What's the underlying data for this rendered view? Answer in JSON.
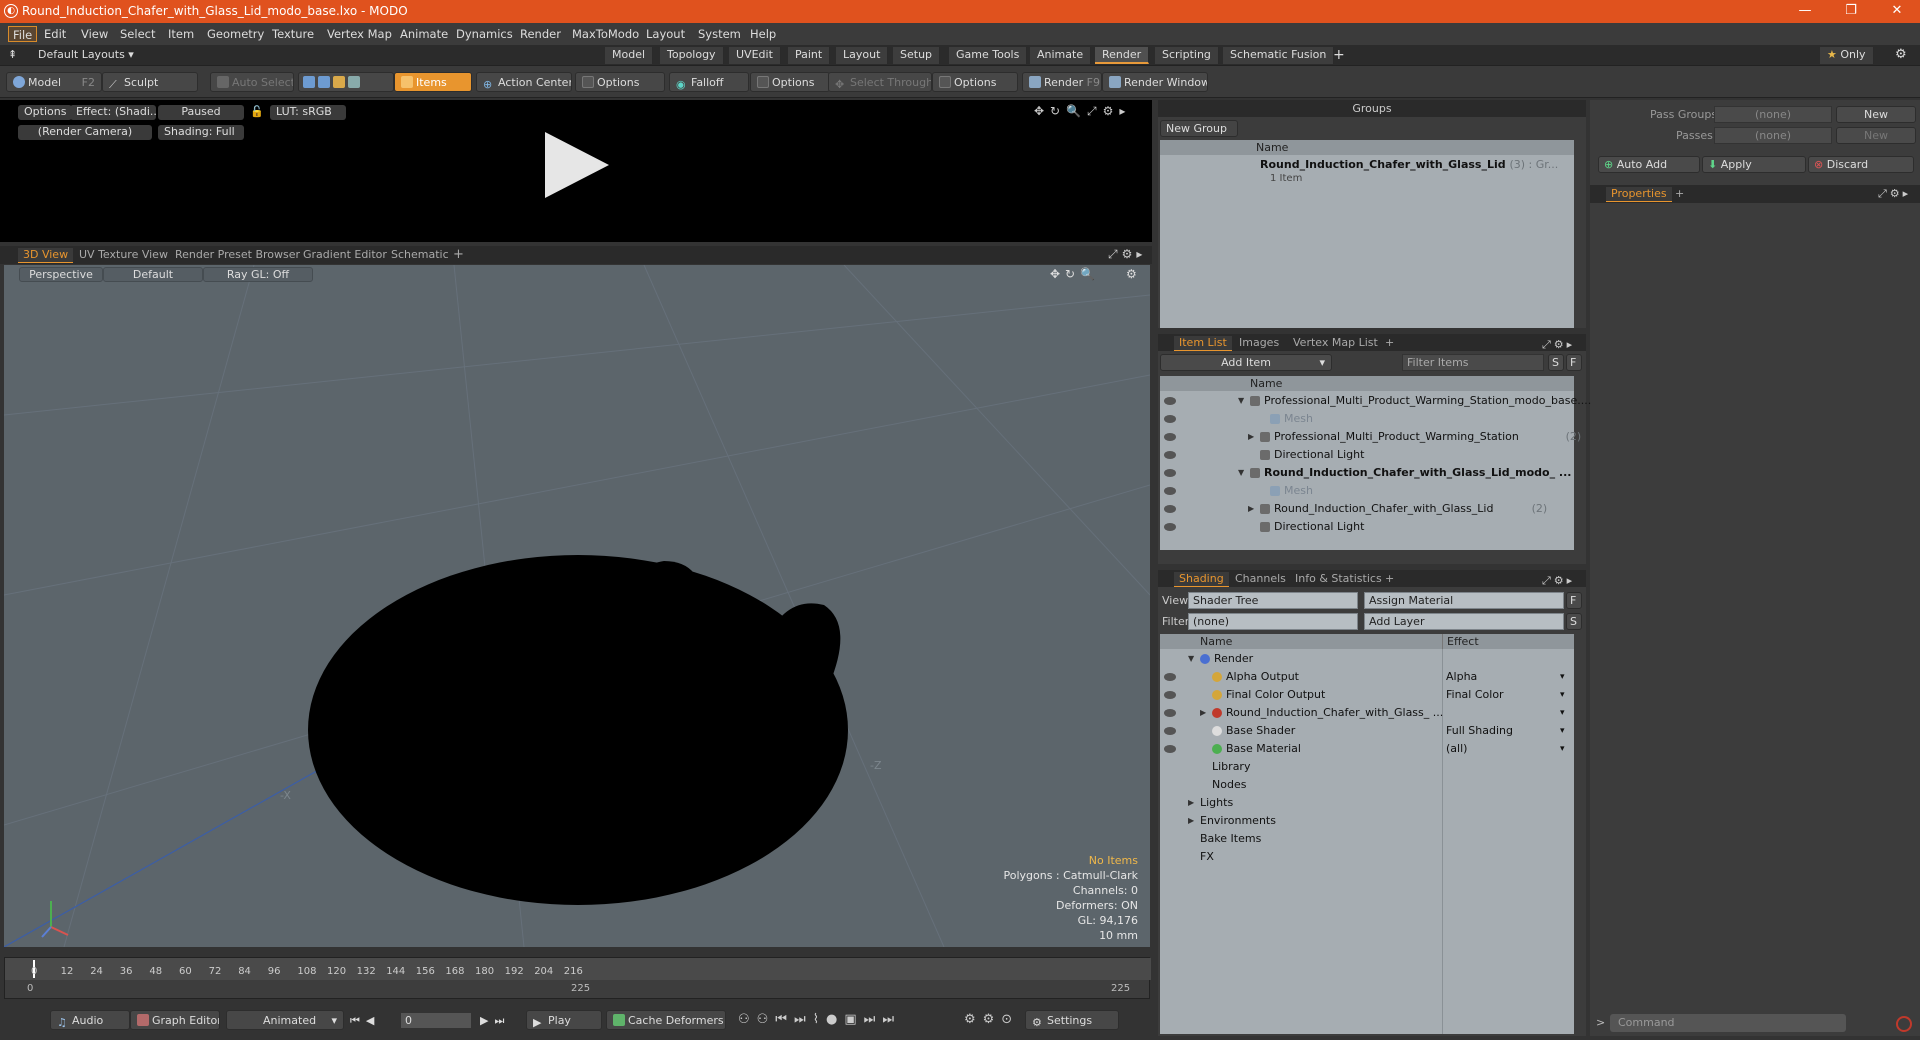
{
  "window": {
    "title": "Round_Induction_Chafer_with_Glass_Lid_modo_base.lxo - MODO"
  },
  "menu": [
    "File",
    "Edit",
    "View",
    "Select",
    "Item",
    "Geometry",
    "Texture",
    "Vertex Map",
    "Animate",
    "Dynamics",
    "Render",
    "MaxToModo",
    "Layout",
    "System",
    "Help"
  ],
  "layouts": {
    "dropdown": "Default Layouts ▾",
    "tabs": [
      "Model",
      "Topology",
      "UVEdit",
      "Paint",
      "Layout",
      "Setup",
      "Game Tools",
      "Animate",
      "Render",
      "Scripting",
      "Schematic Fusion"
    ],
    "active": "Render",
    "only": "Only"
  },
  "toolbar": {
    "model": "Model",
    "model_key": "F2",
    "sculpt": "Sculpt",
    "auto_select": "Auto Select",
    "items": "Items",
    "action_center": "Action Center",
    "options1": "Options",
    "falloff": "Falloff",
    "options2": "Options",
    "select_through": "Select Through",
    "options3": "Options",
    "render": "Render",
    "render_key": "F9",
    "render_window": "Render Window"
  },
  "preview": {
    "options": "Options",
    "effect": "Effect: (Shadi...",
    "paused": "Paused",
    "lut": "LUT: sRGB",
    "camera": "(Render Camera)",
    "shading": "Shading: Full"
  },
  "viewtabs": [
    "3D View",
    "UV Texture View",
    "Render Preset Browser",
    "Gradient Editor",
    "Schematic"
  ],
  "viewport": {
    "perspective": "Perspective",
    "default": "Default",
    "raygl": "Ray GL: Off",
    "no_items": "No Items",
    "polygons": "Polygons : Catmull-Clark",
    "channels": "Channels: 0",
    "deformers": "Deformers: ON",
    "gl": "GL: 94,176",
    "scale": "10 mm",
    "axis_x": "-X",
    "axis_z": "-Z"
  },
  "timeline": {
    "ticks": [
      "0",
      "12",
      "24",
      "36",
      "48",
      "60",
      "72",
      "84",
      "96",
      "108",
      "120",
      "132",
      "144",
      "156",
      "168",
      "180",
      "192",
      "204",
      "216"
    ],
    "start": "0",
    "end": "225",
    "end2": "225"
  },
  "bottom": {
    "audio": "Audio",
    "graph_editor": "Graph Editor",
    "animated": "Animated",
    "frame": "0",
    "play": "Play",
    "cache": "Cache Deformers",
    "settings": "Settings"
  },
  "groups": {
    "title": "Groups",
    "new_group": "New Group",
    "name_col": "Name",
    "item_name": "Round_Induction_Chafer_with_Glass_Lid",
    "item_count": "(3) : Gr...",
    "item_sub": "1 Item"
  },
  "passes": {
    "pass_groups": "Pass Groups",
    "passes": "Passes",
    "none1": "(none)",
    "none2": "(none)",
    "new1": "New",
    "new2": "New",
    "auto_add": "Auto Add",
    "apply": "Apply",
    "discard": "Discard",
    "properties": "Properties"
  },
  "itemlist": {
    "tabs": [
      "Item List",
      "Images",
      "Vertex Map List"
    ],
    "add_item": "Add Item",
    "filter": "Filter Items",
    "s": "S",
    "f": "F",
    "name_col": "Name",
    "rows": [
      {
        "label": "Professional_Multi_Product_Warming_Station_modo_base....",
        "indent": 0,
        "bold": false,
        "dim": false,
        "expand": "▼"
      },
      {
        "label": "Mesh",
        "indent": 2,
        "bold": false,
        "dim": true,
        "expand": ""
      },
      {
        "label": "Professional_Multi_Product_Warming_Station",
        "suffix": "(2)",
        "indent": 1,
        "bold": false,
        "dim": false,
        "expand": "▶"
      },
      {
        "label": "Directional Light",
        "indent": 1,
        "bold": false,
        "dim": false,
        "expand": ""
      },
      {
        "label": "Round_Induction_Chafer_with_Glass_Lid_modo_ ...",
        "indent": 0,
        "bold": true,
        "dim": false,
        "expand": "▼"
      },
      {
        "label": "Mesh",
        "indent": 2,
        "bold": false,
        "dim": true,
        "expand": ""
      },
      {
        "label": "Round_Induction_Chafer_with_Glass_Lid",
        "suffix": "(2)",
        "indent": 1,
        "bold": false,
        "dim": false,
        "expand": "▶"
      },
      {
        "label": "Directional Light",
        "indent": 1,
        "bold": false,
        "dim": false,
        "expand": ""
      }
    ]
  },
  "shading": {
    "tabs": [
      "Shading",
      "Channels",
      "Info & Statistics"
    ],
    "view_label": "View",
    "view_value": "Shader Tree",
    "assign": "Assign Material",
    "filter_label": "Filter",
    "filter_value": "(none)",
    "add_layer": "Add Layer",
    "f": "F",
    "s": "S",
    "name_col": "Name",
    "effect_col": "Effect",
    "rows": [
      {
        "label": "Render",
        "effect": "",
        "indent": 0,
        "icon": "#4a6fd1",
        "expand": "▼"
      },
      {
        "label": "Alpha Output",
        "effect": "Alpha",
        "indent": 1,
        "icon": "#d4a63a",
        "expand": ""
      },
      {
        "label": "Final Color Output",
        "effect": "Final Color",
        "indent": 1,
        "icon": "#d4a63a",
        "expand": ""
      },
      {
        "label": "Round_Induction_Chafer_with_Glass_ ...",
        "effect": "",
        "indent": 1,
        "icon": "#c0392b",
        "expand": "▶"
      },
      {
        "label": "Base Shader",
        "effect": "Full Shading",
        "indent": 1,
        "icon": "#dddddd",
        "expand": ""
      },
      {
        "label": "Base Material",
        "effect": "(all)",
        "indent": 1,
        "icon": "#4caf50",
        "expand": ""
      },
      {
        "label": "Library",
        "effect": "",
        "indent": 1,
        "icon": "",
        "expand": ""
      },
      {
        "label": "Nodes",
        "effect": "",
        "indent": 1,
        "icon": "",
        "expand": ""
      },
      {
        "label": "Lights",
        "effect": "",
        "indent": 0,
        "icon": "",
        "expand": "▶"
      },
      {
        "label": "Environments",
        "effect": "",
        "indent": 0,
        "icon": "",
        "expand": "▶"
      },
      {
        "label": "Bake Items",
        "effect": "",
        "indent": 0,
        "icon": "",
        "expand": ""
      },
      {
        "label": "FX",
        "effect": "",
        "indent": 0,
        "icon": "",
        "expand": ""
      }
    ]
  },
  "command": {
    "placeholder": "Command"
  }
}
